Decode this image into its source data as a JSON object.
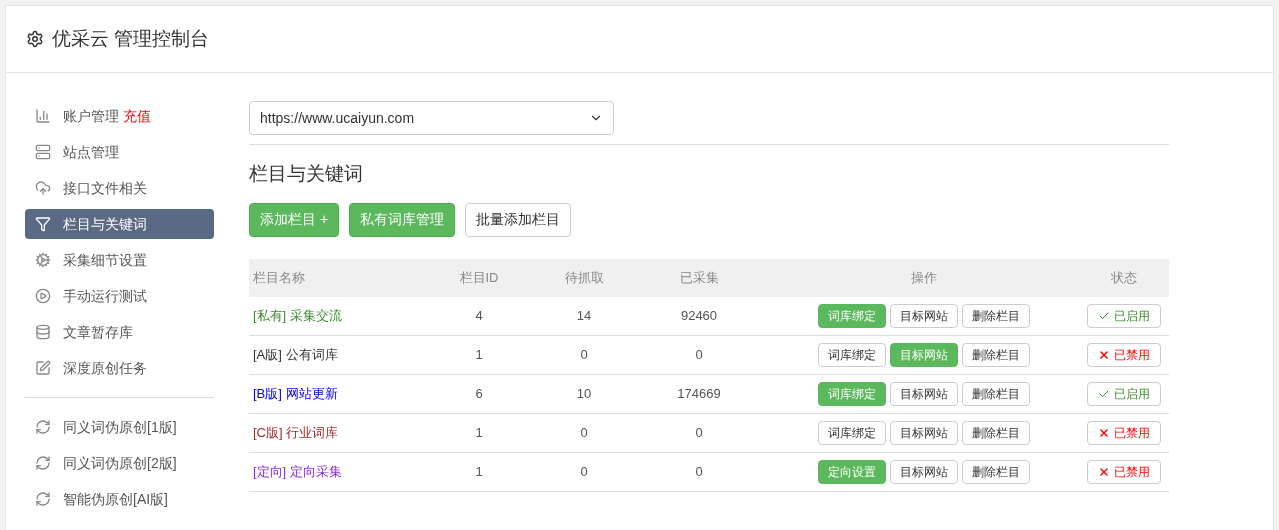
{
  "header": {
    "title": "优采云 管理控制台"
  },
  "sidebar": {
    "groups": [
      {
        "items": [
          {
            "label": "账户管理",
            "badge": "充值",
            "selected": false
          },
          {
            "label": "站点管理",
            "selected": false
          },
          {
            "label": "接口文件相关",
            "selected": false
          },
          {
            "label": "栏目与关键词",
            "selected": true
          },
          {
            "label": "采集细节设置",
            "selected": false
          },
          {
            "label": "手动运行测试",
            "selected": false
          },
          {
            "label": "文章暂存库",
            "selected": false
          },
          {
            "label": "深度原创任务",
            "selected": false
          }
        ]
      },
      {
        "items": [
          {
            "label": "同义词伪原创[1版]",
            "selected": false
          },
          {
            "label": "同义词伪原创[2版]",
            "selected": false
          },
          {
            "label": "智能伪原创[AI版]",
            "selected": false
          }
        ]
      }
    ]
  },
  "site_select": {
    "value": "https://www.ucaiyun.com"
  },
  "section_title": "栏目与关键词",
  "toolbar": [
    {
      "label": "添加栏目 +",
      "primary": true
    },
    {
      "label": "私有词库管理",
      "primary": true
    },
    {
      "label": "批量添加栏目",
      "primary": false
    }
  ],
  "table": {
    "columns": [
      "栏目名称",
      "栏目ID",
      "待抓取",
      "已采集",
      "操作",
      "状态"
    ],
    "rows": [
      {
        "tag": "[私有]",
        "name": "采集交流",
        "color": "#3c8a2e",
        "id": "4",
        "pending": "14",
        "collected": "92460",
        "actions": [
          {
            "label": "词库绑定",
            "primary": true
          },
          {
            "label": "目标网站",
            "primary": false
          },
          {
            "label": "删除栏目",
            "primary": false
          }
        ],
        "status": "已启用",
        "enabled": true
      },
      {
        "tag": "[A版]",
        "name": "公有词库",
        "color": "#333333",
        "id": "1",
        "pending": "0",
        "collected": "0",
        "actions": [
          {
            "label": "词库绑定",
            "primary": false
          },
          {
            "label": "目标网站",
            "primary": true
          },
          {
            "label": "删除栏目",
            "primary": false
          }
        ],
        "status": "已禁用",
        "enabled": false
      },
      {
        "tag": "[B版]",
        "name": "网站更新",
        "color": "#0000ee",
        "id": "6",
        "pending": "10",
        "collected": "174669",
        "actions": [
          {
            "label": "词库绑定",
            "primary": true
          },
          {
            "label": "目标网站",
            "primary": false
          },
          {
            "label": "删除栏目",
            "primary": false
          }
        ],
        "status": "已启用",
        "enabled": true
      },
      {
        "tag": "[C版]",
        "name": "行业词库",
        "color": "#a52a2a",
        "id": "1",
        "pending": "0",
        "collected": "0",
        "actions": [
          {
            "label": "词库绑定",
            "primary": false
          },
          {
            "label": "目标网站",
            "primary": false
          },
          {
            "label": "删除栏目",
            "primary": false
          }
        ],
        "status": "已禁用",
        "enabled": false
      },
      {
        "tag": "[定向]",
        "name": "定向采集",
        "color": "#8a2be2",
        "id": "1",
        "pending": "0",
        "collected": "0",
        "actions": [
          {
            "label": "定向设置",
            "primary": true
          },
          {
            "label": "目标网站",
            "primary": false
          },
          {
            "label": "删除栏目",
            "primary": false
          }
        ],
        "status": "已禁用",
        "enabled": false
      }
    ]
  }
}
